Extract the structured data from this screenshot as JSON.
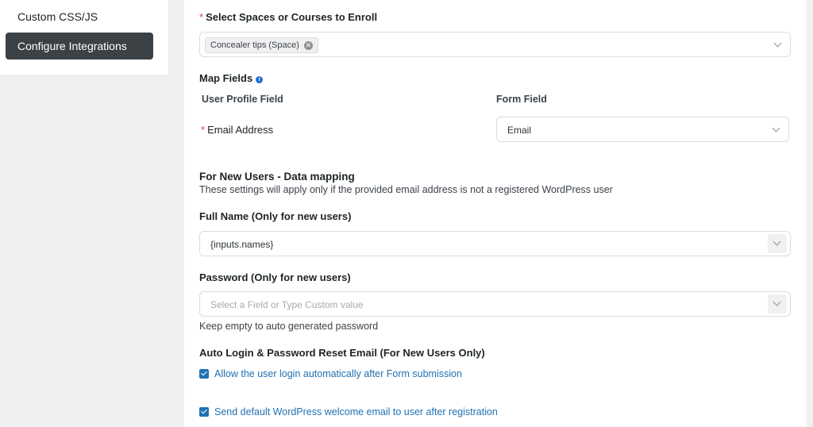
{
  "sidebar": {
    "items": [
      {
        "label": "Custom CSS/JS"
      },
      {
        "label": "Configure Integrations"
      }
    ]
  },
  "enroll": {
    "label": "Select Spaces or Courses to Enroll",
    "selected_tag": "Concealer tips (Space)"
  },
  "map_fields": {
    "title": "Map Fields",
    "col_user_profile": "User Profile Field",
    "col_form_field": "Form Field",
    "email_label": "Email Address",
    "email_value": "Email"
  },
  "new_users": {
    "heading": "For New Users - Data mapping",
    "description": "These settings will apply only if the provided email address is not a registered WordPress user",
    "full_name_label": "Full Name (Only for new users)",
    "full_name_value": "{inputs.names}",
    "password_label": "Password (Only for new users)",
    "password_placeholder": "Select a Field or Type Custom value",
    "password_help": "Keep empty to auto generated password"
  },
  "auto_login": {
    "heading": "Auto Login & Password Reset Email (For New Users Only)",
    "options": [
      {
        "label": "Allow the user login automatically after Form submission",
        "checked": true
      },
      {
        "label": "Send default WordPress welcome email to user after registration",
        "checked": true
      }
    ]
  },
  "colors": {
    "accent": "#2271b1",
    "required": "#e53e3e",
    "active_nav": "#3c4146"
  }
}
